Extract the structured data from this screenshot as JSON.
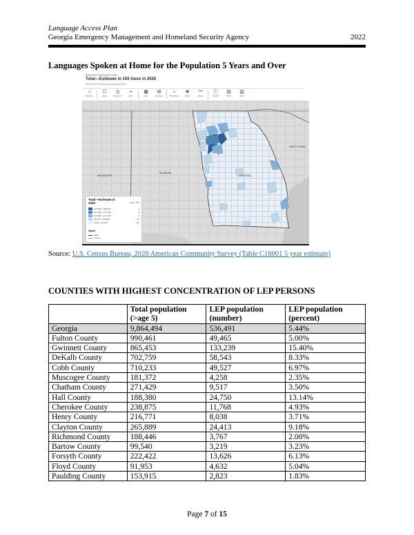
{
  "header": {
    "doc_title": "Language Access Plan",
    "agency": "Georgia Emergency Management and Homeland Security Agency",
    "year": "2022"
  },
  "section_title": "Languages Spoken at Home for the Population 5 Years and Over",
  "map": {
    "survey_label": "American Community Survey",
    "title": "Total—Estimate in 159 Geos in 2020",
    "subtitle": "2020: ACS 5-Year Estimates Detailed Tables",
    "toolbar": [
      {
        "icon": "basemap-icon",
        "glyph": "⌂",
        "label": "Variables"
      },
      {
        "icon": "select-icon",
        "glyph": "☐",
        "label": "Select"
      },
      {
        "icon": "draw-icon",
        "glyph": "◎",
        "label": "Draw Zone"
      },
      {
        "icon": "layer-icon",
        "glyph": "⌖",
        "label": "Layer"
      },
      {
        "icon": "year-icon",
        "glyph": "▦",
        "label": "Year"
      },
      {
        "icon": "basemap-grid-icon",
        "glyph": "⊞",
        "label": "Basemap"
      },
      {
        "icon": "boundaries-icon",
        "glyph": "⌂",
        "label": "Boundaries"
      },
      {
        "icon": "colors-icon",
        "glyph": "❀",
        "label": "Colors"
      },
      {
        "icon": "share-icon",
        "glyph": "⌤",
        "label": "Shapes"
      },
      {
        "icon": "identify-icon",
        "glyph": "ⓘ",
        "label": "Identify"
      },
      {
        "icon": "table-icon",
        "glyph": "▤",
        "label": "Table"
      },
      {
        "icon": "notes-icon",
        "glyph": "▥",
        "label": "Notes"
      }
    ],
    "place_labels": {
      "mississippi": "MISSISSIPPI",
      "alabama": "ALABAMA",
      "georgia": "GEORGIA",
      "south_carolina": "SOUTH CARO"
    },
    "legend": {
      "title": "Total—Estimate in 2020",
      "shown": "Geos: 159",
      "classes": [
        {
          "range": "770,229—990,461",
          "count": "2",
          "color": "#2b5d9b"
        },
        {
          "range": "271,430—770,228",
          "count": "2",
          "color": "#4a84bd"
        },
        {
          "range": "103,816—271,429",
          "count": "6",
          "color": "#7fb0da"
        },
        {
          "range": "36,631—103,815",
          "count": "23",
          "color": "#bcd6ec"
        },
        {
          "range": "5,100—36,630",
          "count": "126",
          "color": "#e9f0f8"
        }
      ],
      "styles_title": "Styles",
      "styles": [
        "State",
        "County"
      ]
    },
    "colors": {
      "background": "#dcdcdc",
      "county_line": "#b8b8b8",
      "state_line": "#333333",
      "georgia_base": "#e9f0f8"
    }
  },
  "source": {
    "prefix": "Source: ",
    "link_text": "U.S. Census Bureau, 2020 American Community Survey (Table C16001 5 year estimate)"
  },
  "table_title": "COUNTIES WITH HIGHEST CONCENTRATION OF LEP PERSONS",
  "table": {
    "headers": [
      "",
      "Total population (>age 5)",
      "LEP population (number)",
      "LEP population (percent)"
    ],
    "header_lines": [
      [
        "",
        ""
      ],
      [
        "Total population",
        "(>age 5)"
      ],
      [
        "LEP population",
        "(number)"
      ],
      [
        "LEP population",
        "(percent)"
      ]
    ],
    "rows": [
      [
        "Georgia",
        "9,864,494",
        "536,491",
        "5.44%"
      ],
      [
        "Fulton County",
        "990,461",
        "49,465",
        "5.00%"
      ],
      [
        "Gwinnett County",
        "865,453",
        "133,239",
        "15.40%"
      ],
      [
        "DeKalb County",
        "702,759",
        "58,543",
        "8.33%"
      ],
      [
        "Cobb County",
        "710,233",
        "49,527",
        "6.97%"
      ],
      [
        "Muscogee County",
        "181,372",
        "4,258",
        "2.35%"
      ],
      [
        "Chatham County",
        "271,429",
        "9,517",
        "3.50%"
      ],
      [
        "Hall County",
        "188,380",
        "24,750",
        "13.14%"
      ],
      [
        "Cherokee County",
        "238,875",
        "11,768",
        "4.93%"
      ],
      [
        "Henry County",
        "216,771",
        "8,038",
        "3.71%"
      ],
      [
        "Clayton County",
        "265,889",
        "24,413",
        "9.18%"
      ],
      [
        "Richmond County",
        "188,446",
        "3,767",
        "2.00%"
      ],
      [
        "Bartow County",
        "99,540",
        "3,219",
        "3.23%"
      ],
      [
        "Forsyth County",
        "222,422",
        "13,626",
        "6.13%"
      ],
      [
        "Floyd County",
        "91,953",
        "4,632",
        "5.04%"
      ],
      [
        "Paulding County",
        "153,915",
        "2,823",
        "1.83%"
      ]
    ],
    "highlight_row": 0,
    "highlight_color": "#d9d9d9"
  },
  "footer": {
    "prefix": "Page ",
    "page": "7",
    "middle": " of ",
    "total": "15"
  }
}
